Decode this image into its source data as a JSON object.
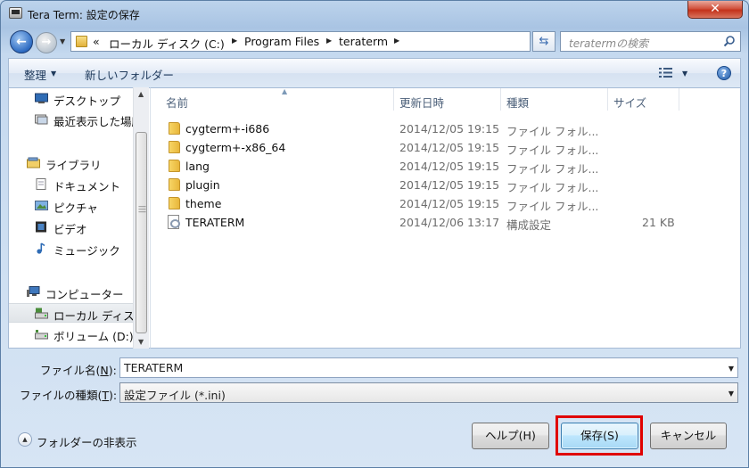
{
  "window": {
    "title": "Tera Term: 設定の保存",
    "close_label": "✕"
  },
  "address_bar": {
    "overflow": "«",
    "parts": [
      "ローカル ディスク (C:)",
      "Program Files",
      "teraterm"
    ]
  },
  "search": {
    "placeholder": "teratermの検索"
  },
  "toolbar": {
    "organize": "整理",
    "new_folder": "新しいフォルダー",
    "help": "?"
  },
  "nav": {
    "items": [
      {
        "label": "デスクトップ",
        "icon": "desktop-icon"
      },
      {
        "label": "最近表示した場所",
        "icon": "recent-places-icon"
      },
      {
        "label": "ライブラリ",
        "icon": "library-icon"
      },
      {
        "label": "ドキュメント",
        "icon": "documents-icon"
      },
      {
        "label": "ピクチャ",
        "icon": "pictures-icon"
      },
      {
        "label": "ビデオ",
        "icon": "videos-icon"
      },
      {
        "label": "ミュージック",
        "icon": "music-icon"
      },
      {
        "label": "コンピューター",
        "icon": "computer-icon"
      },
      {
        "label": "ローカル ディスク (C:)",
        "icon": "drive-icon",
        "selected": true
      },
      {
        "label": "ボリューム (D:)",
        "icon": "drive-icon"
      }
    ]
  },
  "columns": {
    "name": "名前",
    "date": "更新日時",
    "type": "種類",
    "size": "サイズ"
  },
  "files": [
    {
      "name": "cygterm+-i686",
      "date": "2014/12/05 19:15",
      "type": "ファイル フォル...",
      "size": "",
      "kind": "folder"
    },
    {
      "name": "cygterm+-x86_64",
      "date": "2014/12/05 19:15",
      "type": "ファイル フォル...",
      "size": "",
      "kind": "folder"
    },
    {
      "name": "lang",
      "date": "2014/12/05 19:15",
      "type": "ファイル フォル...",
      "size": "",
      "kind": "folder"
    },
    {
      "name": "plugin",
      "date": "2014/12/05 19:15",
      "type": "ファイル フォル...",
      "size": "",
      "kind": "folder"
    },
    {
      "name": "theme",
      "date": "2014/12/05 19:15",
      "type": "ファイル フォル...",
      "size": "",
      "kind": "folder"
    },
    {
      "name": "TERATERM",
      "date": "2014/12/06 13:17",
      "type": "構成設定",
      "size": "21 KB",
      "kind": "file"
    }
  ],
  "form": {
    "filename_label": "ファイル名(",
    "filename_key": "N",
    "filename_value": "TERATERM",
    "filetype_label": "ファイルの種類(",
    "filetype_key": "T",
    "filetype_value": "設定ファイル (*.ini)"
  },
  "footer": {
    "hide_folders": "フォルダーの非表示",
    "help_button": "ヘルプ(H)",
    "save_button": "保存(S)",
    "cancel_button": "キャンセル"
  },
  "colors": {
    "highlight": "#e00000",
    "accent": "#3c7fb1"
  }
}
